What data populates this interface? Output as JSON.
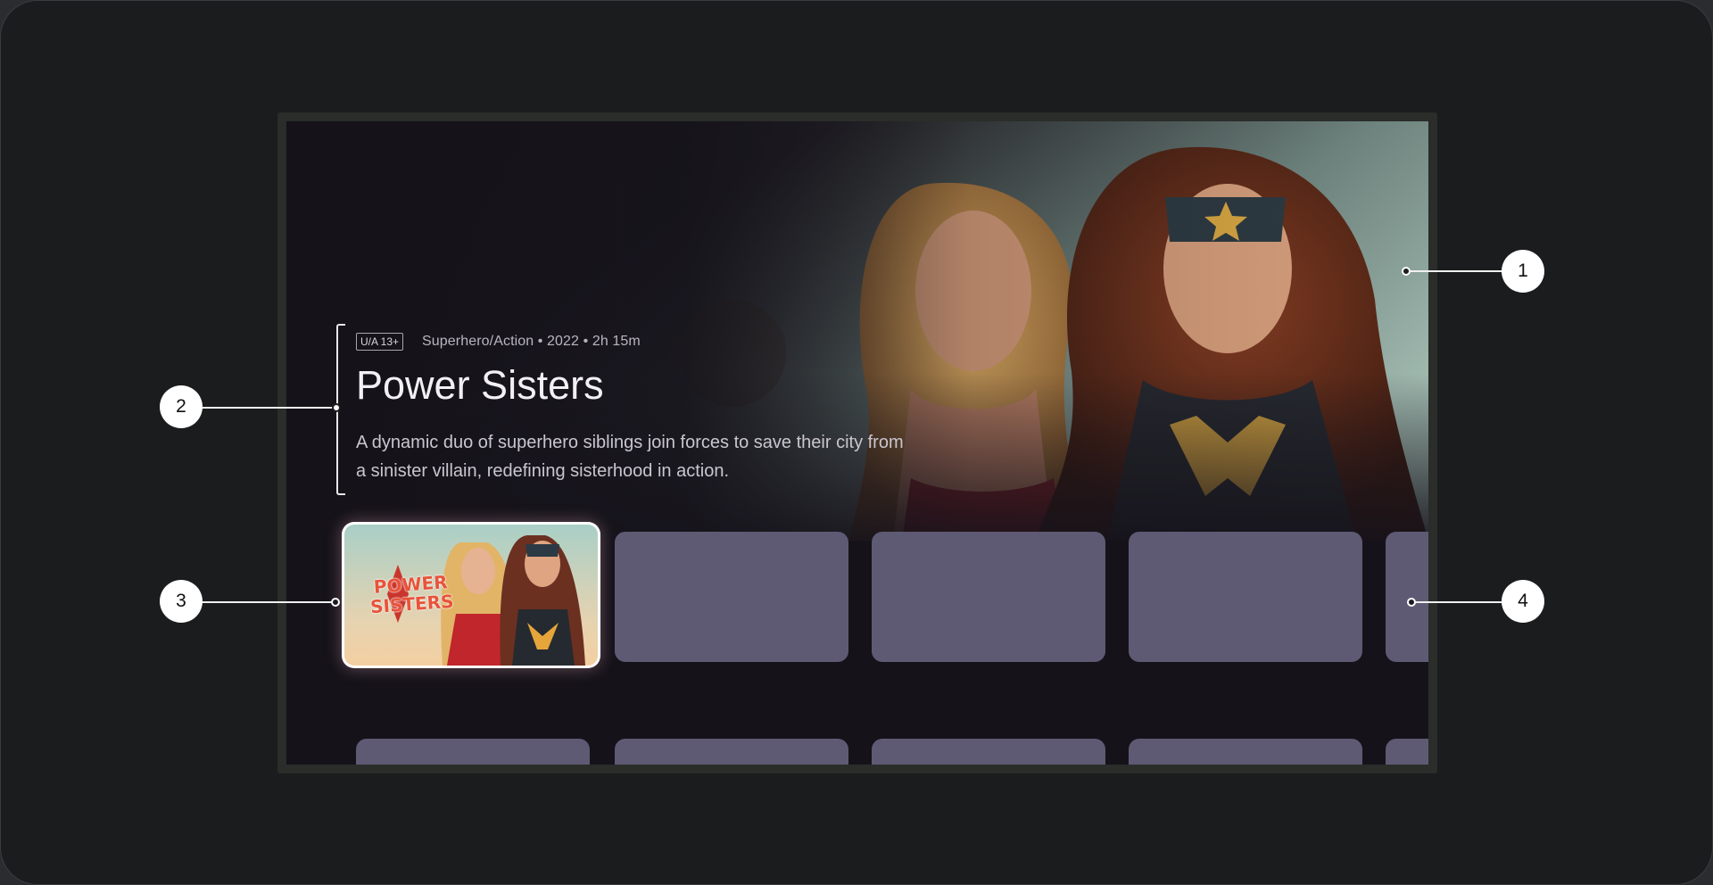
{
  "hero": {
    "rating": "U/A 13+",
    "meta": "Superhero/Action • 2022 • 2h 15m",
    "title": "Power Sisters",
    "description": "A dynamic duo of superhero siblings join forces to save their city from a sinister villain, redefining sisterhood in action."
  },
  "focused_card": {
    "logo_line1": "POWER",
    "logo_line2": "SISTERS"
  },
  "callouts": [
    "1",
    "2",
    "3",
    "4"
  ],
  "colors": {
    "page_bg": "#1b1c1e",
    "screen_bg": "#15121a",
    "card_placeholder": "#5f5a73",
    "focus_ring": "#ffffff",
    "callout_badge": "#ffffff"
  }
}
